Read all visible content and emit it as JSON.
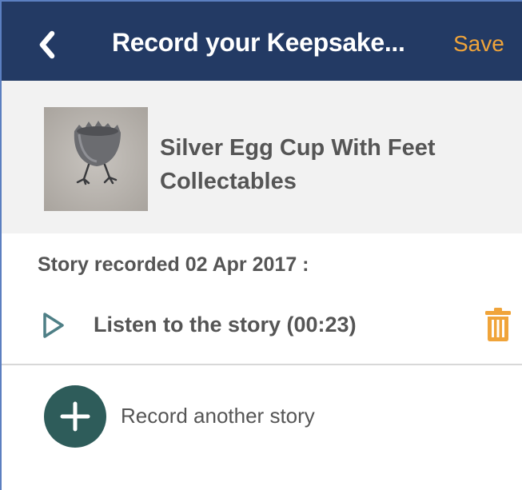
{
  "navbar": {
    "title": "Record your Keepsake...",
    "save_label": "Save",
    "back_icon": "chevron-left-icon",
    "background": "#233a64",
    "accent": "#f0a43a"
  },
  "item": {
    "title": "Silver Egg Cup With Feet Collectables",
    "thumbnail_alt": "Silver egg cup photo"
  },
  "story": {
    "recorded_label": "Story recorded 02 Apr 2017 :",
    "listen_label": "Listen to the story (00:23)",
    "play_icon": "play-icon",
    "delete_icon": "trash-icon",
    "delete_color": "#f0a43a"
  },
  "record": {
    "label": "Record another story",
    "icon": "plus-icon",
    "button_color": "#2e5c5a"
  }
}
